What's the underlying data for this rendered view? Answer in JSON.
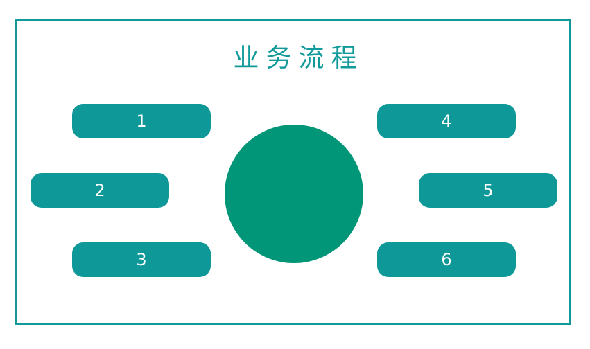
{
  "title": "业务流程",
  "colors": {
    "frame": "#12989a",
    "title": "#119a9a",
    "pill": "#0f9898",
    "circle": "#019677",
    "pill_text": "#ffffff"
  },
  "steps": [
    {
      "label": "1"
    },
    {
      "label": "2"
    },
    {
      "label": "3"
    },
    {
      "label": "4"
    },
    {
      "label": "5"
    },
    {
      "label": "6"
    }
  ]
}
